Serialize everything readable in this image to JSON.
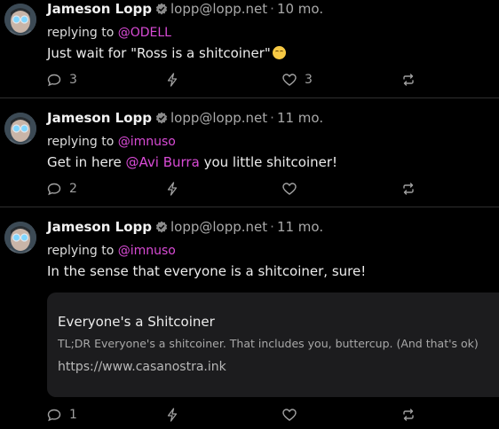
{
  "posts": [
    {
      "author": "Jameson Lopp",
      "nip05": "lopp@lopp.net",
      "separator": "·",
      "time": "10 mo.",
      "replying_prefix": "replying to",
      "replying_to": "@ODELL",
      "content_text": "Just wait for \"Ross is a shitcoiner\"",
      "content_emoji": "smirk-emoji",
      "reply_count": "3",
      "like_count": "3"
    },
    {
      "author": "Jameson Lopp",
      "nip05": "lopp@lopp.net",
      "separator": "·",
      "time": "11 mo.",
      "replying_prefix": "replying to",
      "replying_to": "@imnuso",
      "content_before": "Get in here",
      "content_mention": "@Avi Burra",
      "content_after": "you little shitcoiner!",
      "reply_count": "2"
    },
    {
      "author": "Jameson Lopp",
      "nip05": "lopp@lopp.net",
      "separator": "·",
      "time": "11 mo.",
      "replying_prefix": "replying to",
      "replying_to": "@imnuso",
      "content_text": "In the sense that everyone is a shitcoiner, sure!",
      "link_preview": {
        "title": "Everyone's a Shitcoiner",
        "description": "TL;DR Everyone's a shitcoiner. That includes you, buttercup. (And that's ok)",
        "url": "https://www.casanostra.ink"
      },
      "reply_count": "1"
    }
  ],
  "colors": {
    "background": "#000000",
    "mention": "#d94bd6",
    "muted": "#a9a9a9",
    "divider": "#2f2f2f",
    "preview_bg": "#1c1c1e"
  },
  "icons": [
    "avatar",
    "verified-badge-icon",
    "reply-icon",
    "zap-icon",
    "like-icon",
    "repost-icon"
  ]
}
